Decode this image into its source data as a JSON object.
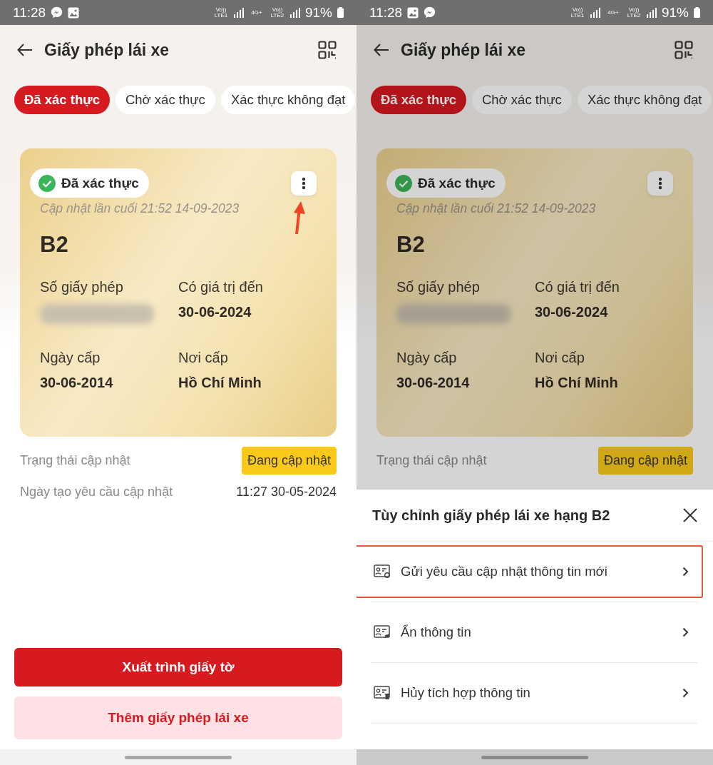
{
  "screens": [
    {
      "status_bar": {
        "time": "11:28",
        "notification_icons": [
          {
            "kind": "messenger"
          },
          {
            "kind": "image"
          }
        ],
        "network_labels": [
          "Vo)) LTE1",
          "4G+",
          "Vo)) LTE2"
        ],
        "battery": "91%"
      },
      "title": "Giấy phép lái xe",
      "tabs": [
        {
          "label": "Đã xác thực",
          "selected": true
        },
        {
          "label": "Chờ xác thực",
          "selected": false
        },
        {
          "label": "Xác thực không đạt",
          "selected": false
        }
      ],
      "card": {
        "status": "Đã xác thực",
        "updated": "Cập nhật lần cuối 21:52 14-09-2023",
        "license_class": "B2",
        "pointer_arrow": true,
        "fields": [
          {
            "label": "Số giấy phép",
            "redacted": true
          },
          {
            "label": "Có giá trị đến",
            "value": "30-06-2024",
            "redacted": false
          },
          {
            "label": "Ngày cấp",
            "value": "30-06-2014",
            "redacted": false
          },
          {
            "label": "Nơi cấp",
            "value": "Hồ Chí Minh",
            "redacted": false
          }
        ]
      },
      "info_rows": [
        {
          "label": "Trạng thái cập nhật",
          "value": "Đang cập nhật",
          "kind": "badge"
        },
        {
          "label": "Ngày tạo yêu cầu cập nhật",
          "value": "11:27 30-05-2024",
          "kind": "text"
        }
      ],
      "buttons": [
        {
          "label": "Xuất trình giấy tờ",
          "kind": "primary"
        },
        {
          "label": "Thêm giấy phép lái xe",
          "kind": "secondary"
        }
      ],
      "dimmed": false
    },
    {
      "status_bar": {
        "time": "11:28",
        "notification_icons": [
          {
            "kind": "image"
          },
          {
            "kind": "messenger"
          }
        ],
        "network_labels": [
          "Vo)) LTE1",
          "4G+",
          "Vo)) LTE2"
        ],
        "battery": "91%"
      },
      "title": "Giấy phép lái xe",
      "tabs": [
        {
          "label": "Đã xác thực",
          "selected": true
        },
        {
          "label": "Chờ xác thực",
          "selected": false
        },
        {
          "label": "Xác thực không đạt",
          "selected": false
        }
      ],
      "card": {
        "status": "Đã xác thực",
        "updated": "Cập nhật lần cuối 21:52 14-09-2023",
        "license_class": "B2",
        "pointer_arrow": false,
        "fields": [
          {
            "label": "Số giấy phép",
            "redacted": true
          },
          {
            "label": "Có giá trị đến",
            "value": "30-06-2024",
            "redacted": false
          },
          {
            "label": "Ngày cấp",
            "value": "30-06-2014",
            "redacted": false
          },
          {
            "label": "Nơi cấp",
            "value": "Hồ Chí Minh",
            "redacted": false
          }
        ]
      },
      "info_rows": [
        {
          "label": "Trạng thái cập nhật",
          "value": "Đang cập nhật",
          "kind": "badge"
        }
      ],
      "dimmed": true,
      "sheet": {
        "title": "Tùy chỉnh giấy phép lái xe hạng B2",
        "items": [
          {
            "label": "Gửi yêu cầu cập nhật thông tin mới",
            "kind": "update",
            "highlighted": true
          },
          {
            "label": "Ẩn thông tin",
            "kind": "hide",
            "highlighted": false
          },
          {
            "label": "Hủy tích hợp thông tin",
            "kind": "remove",
            "highlighted": false
          }
        ]
      }
    }
  ]
}
